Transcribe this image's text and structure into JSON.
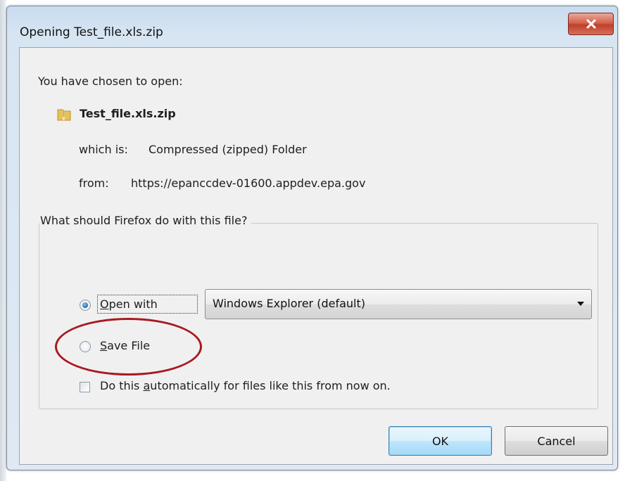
{
  "window": {
    "title": "Opening Test_file.xls.zip"
  },
  "icons": {
    "close": "close-icon",
    "file": "zip-file-icon"
  },
  "dialog": {
    "prompt": "You have chosen to open:",
    "file_name": "Test_file.xls.zip",
    "which_is_label": "which is:",
    "which_is_value": "Compressed (zipped) Folder",
    "from_label": "from:",
    "from_value": "https://epanccdev-01600.appdev.epa.gov",
    "group_title": "What should Firefox do with this file?",
    "open_with": {
      "label_pre": "",
      "label_underlined": "O",
      "label_post": "pen with",
      "selected": true
    },
    "app_select": {
      "value": "Windows Explorer (default)"
    },
    "save_file": {
      "label_underlined": "S",
      "label_post": "ave File",
      "selected": false
    },
    "auto": {
      "label_pre": "Do this ",
      "label_underlined": "a",
      "label_post": "utomatically for files like this from now on.",
      "checked": false
    },
    "ok_label": "OK",
    "cancel_label": "Cancel"
  },
  "colors": {
    "annotation": "#a8191f",
    "close_button": "#c9483a",
    "titlebar": "#c9dbee",
    "client_bg": "#f0f0f0"
  }
}
